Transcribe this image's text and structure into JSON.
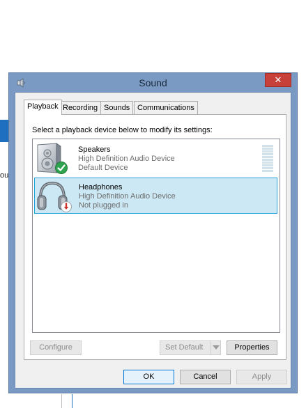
{
  "window": {
    "title": "Sound",
    "close_label": "✕"
  },
  "tabs": [
    {
      "label": "Playback",
      "active": true
    },
    {
      "label": "Recording",
      "active": false
    },
    {
      "label": "Sounds",
      "active": false
    },
    {
      "label": "Communications",
      "active": false
    }
  ],
  "instruction": "Select a playback device below to modify its settings:",
  "devices": [
    {
      "name": "Speakers",
      "driver": "High Definition Audio Device",
      "status": "Default Device",
      "icon": "speaker-icon",
      "badge": "default-check-badge-icon",
      "selected": false
    },
    {
      "name": "Headphones",
      "driver": "High Definition Audio Device",
      "status": "Not plugged in",
      "icon": "headphones-icon",
      "badge": "unplugged-badge-icon",
      "selected": true
    }
  ],
  "panel_buttons": {
    "configure": "Configure",
    "set_default": "Set Default",
    "properties": "Properties"
  },
  "dialog_buttons": {
    "ok": "OK",
    "cancel": "Cancel",
    "apply": "Apply"
  },
  "background": {
    "text_fragment": "ou"
  },
  "colors": {
    "frame": "#7a9ac4",
    "close": "#c7413a",
    "selection": "#cce8f4",
    "selection_border": "#26a0da",
    "check_green": "#2ea44f",
    "unplug_red": "#c8302c"
  }
}
